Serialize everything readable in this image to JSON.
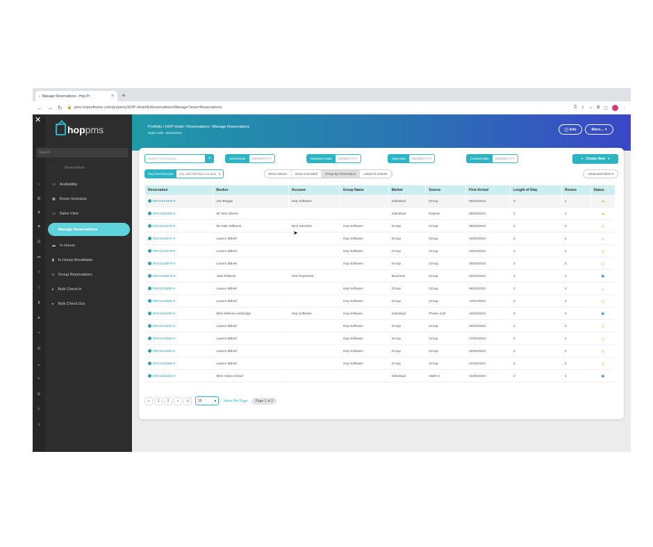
{
  "browser": {
    "tab_title": "Manage Reservations - Hop Pr",
    "url": "pms.hopsoftware.com/property/HOP-Hotel/E/Reservations/Manage?area=Reservations"
  },
  "sidebar": {
    "logo": "hop",
    "logo_suffix": "pms",
    "search_placeholder": "Search",
    "back_label": "Reservations",
    "items": [
      {
        "label": "Availability"
      },
      {
        "label": "Room Schedule"
      },
      {
        "label": "Sales View"
      },
      {
        "label": "Manage Reservations"
      },
      {
        "label": "In House"
      },
      {
        "label": "In House Breakfasts"
      },
      {
        "label": "Group Reservations"
      },
      {
        "label": "Bulk Check In"
      },
      {
        "label": "Bulk Check Out"
      }
    ]
  },
  "header": {
    "breadcrumb": "Portfolio / HOP-Hotel / Reservations / Manage Reservations",
    "night_audit": "Night Audit - 06/03/2023",
    "info_label": "Info",
    "more_label": "More..."
  },
  "filters": {
    "search_placeholder": "Search reservations...",
    "arrival_label": "Arrival Date",
    "departure_label": "Departure Date",
    "stay_label": "Stay Date",
    "created_label": "Created Date",
    "date_placeholder": "DD/MM/YYYY",
    "create_new_label": "Create New",
    "key_card_encoder": "Key Card Encoder",
    "key_card_value": "Key card interface not avai",
    "toggles": [
      "Show Historic",
      "Show Cancelled",
      "Group By Reservation",
      "Linked To Events"
    ],
    "advanced_filters": "Advanced Filters"
  },
  "table": {
    "columns": [
      "Reservation",
      "Booker",
      "Account",
      "Group Name",
      "Market",
      "Source",
      "First Arrival",
      "Length of Stay",
      "Rooms",
      "Status"
    ],
    "rows": [
      {
        "res": "RES1217683",
        "booker": "Joe Bloggs",
        "account": "Hop Software",
        "group": "",
        "market": "Individual",
        "source": "Group",
        "arrival": "06/03/2023",
        "los": "3",
        "rooms": "1",
        "status": "arriving"
      },
      {
        "res": "RES1190365",
        "booker": "Mr Test Alberto",
        "account": "",
        "group": "",
        "market": "Individual",
        "source": "Repeat",
        "arrival": "06/03/2023",
        "los": "1",
        "rooms": "1",
        "status": "arriving"
      },
      {
        "res": "RES1134676",
        "booker": "Mr Dale Williams",
        "account": "Rick Sanchez",
        "group": "Hop Software",
        "market": "Group",
        "source": "Group",
        "arrival": "09/03/2023",
        "los": "2",
        "rooms": "4",
        "status": "confirmed"
      },
      {
        "res": "RES1134677",
        "booker": "Lauren Bithell",
        "account": "",
        "group": "Hop Software",
        "market": "Group",
        "source": "Group",
        "arrival": "16/03/2023",
        "los": "2",
        "rooms": "4",
        "status": "confirmed"
      },
      {
        "res": "RES1134678",
        "booker": "Lauren Bithell",
        "account": "",
        "group": "Hop Software",
        "market": "Group",
        "source": "Group",
        "arrival": "23/03/2023",
        "los": "2",
        "rooms": "4",
        "status": "confirmed"
      },
      {
        "res": "RES1134679",
        "booker": "Lauren Bithell",
        "account": "",
        "group": "Hop Software",
        "market": "Group",
        "source": "Group",
        "arrival": "30/03/2023",
        "los": "2",
        "rooms": "4",
        "status": "confirmed"
      },
      {
        "res": "RES1098179",
        "booker": "Julia Roberts",
        "account": "Test Payments",
        "group": "",
        "market": "Business",
        "source": "Group",
        "arrival": "02/04/2023",
        "los": "1",
        "rooms": "1",
        "status": "provisional"
      },
      {
        "res": "RES1134680",
        "booker": "Lauren Bithell",
        "account": "",
        "group": "Hop Software",
        "market": "Group",
        "source": "Group",
        "arrival": "06/04/2023",
        "los": "2",
        "rooms": "4",
        "status": "confirmed"
      },
      {
        "res": "RES1134681",
        "booker": "Lauren Bithell",
        "account": "",
        "group": "Hop Software",
        "market": "Group",
        "source": "Group",
        "arrival": "13/04/2023",
        "los": "2",
        "rooms": "4",
        "status": "confirmed"
      },
      {
        "res": "RES1150283",
        "booker": "Miss Melissa Harbridge",
        "account": "Hop Software",
        "group": "Hop software",
        "market": "Individual",
        "source": "Phone Call",
        "arrival": "18/04/2023",
        "los": "3",
        "rooms": "2",
        "status": "provisional"
      },
      {
        "res": "RES1134682",
        "booker": "Lauren Bithell",
        "account": "",
        "group": "Hop Software",
        "market": "Group",
        "source": "Group",
        "arrival": "20/04/2023",
        "los": "2",
        "rooms": "4",
        "status": "confirmed"
      },
      {
        "res": "RES1134683",
        "booker": "Lauren Bithell",
        "account": "",
        "group": "Hop Software",
        "market": "Group",
        "source": "Group",
        "arrival": "27/04/2023",
        "los": "2",
        "rooms": "4",
        "status": "confirmed"
      },
      {
        "res": "RES1134684",
        "booker": "Lauren Bithell",
        "account": "",
        "group": "Hop Software",
        "market": "Group",
        "source": "Group",
        "arrival": "04/05/2023",
        "los": "2",
        "rooms": "4",
        "status": "confirmed"
      },
      {
        "res": "RES1134685",
        "booker": "Lauren Bithell",
        "account": "",
        "group": "Hop Software",
        "market": "Group",
        "source": "Group",
        "arrival": "11/05/2023",
        "los": "2",
        "rooms": "4",
        "status": "confirmed"
      },
      {
        "res": "RES1216212",
        "booker": "Miss Hania Sohail",
        "account": "",
        "group": "",
        "market": "Individual",
        "source": "Walk In",
        "arrival": "31/05/2023",
        "los": "2",
        "rooms": "1",
        "status": "provisional"
      }
    ]
  },
  "pager": {
    "pages": [
      "«",
      "1",
      "2",
      "»",
      "»|"
    ],
    "per_page": "15",
    "per_page_label": "Items Per Page",
    "page_of": "Page 1 of 2"
  },
  "colors": {
    "accent": "#2bb5c4",
    "sidebar": "#2d2d2d",
    "band_start": "#1f9aa8",
    "band_end": "#3a47c8"
  }
}
